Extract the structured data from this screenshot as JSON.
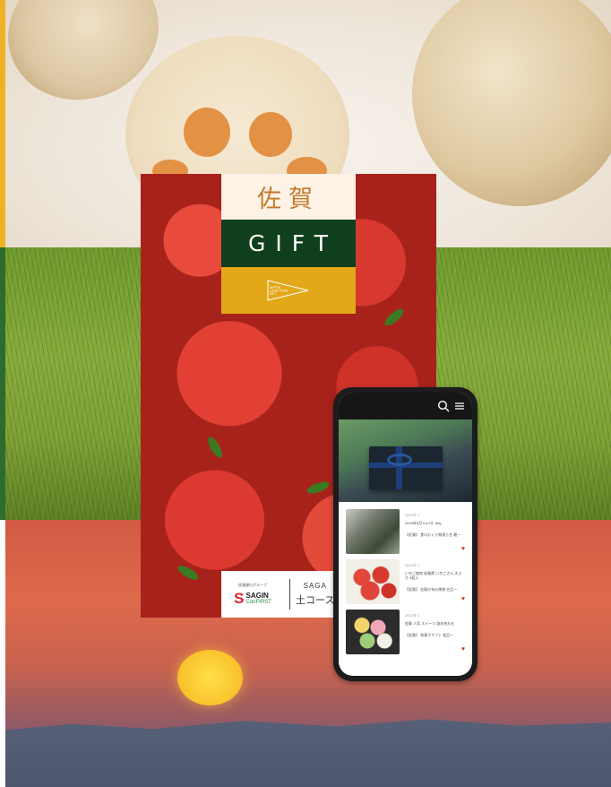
{
  "catalog": {
    "title_kanji": "佐賀",
    "title_gift": "GIFT",
    "badge_text": "NIPPON LOCAL FOOD GIFT",
    "footer": {
      "group_label": "佐賀銀行グループ",
      "sagin_mark": "S",
      "sagin_name": "SAGIN",
      "sagin_sub": "ConFIRST",
      "saga_label": "SAGA",
      "saga_kanji": "土コース"
    }
  },
  "phone": {
    "icons": [
      "search-icon",
      "menu-icon"
    ],
    "items": [
      {
        "date": "2021年 1",
        "title": "2019年5月 Inc.tス .6kg",
        "category": "【佐賀】 食のおくり物通り名 最一",
        "thumb_color": "#3e4a3a"
      },
      {
        "date": "2021年 1",
        "title": "いちご産地 佐賀県 いちごさん 大ぶり 4粒入",
        "category": "【佐賀】 佐賀の旬の果物 名品一",
        "thumb_color": "#c8322a"
      },
      {
        "date": "2021年 1",
        "title": "佐賀 人気 スイーツ 詰め合わせ",
        "category": "【佐賀】 和菓子ギフト 銘品一",
        "thumb_color": "#2c2c2c"
      }
    ]
  },
  "colors": {
    "gift_green": "#0f3f1c",
    "gift_gold": "#e2a81a",
    "kanji_orange": "#c27a2a",
    "accent_yellow": "#f0b225",
    "accent_green": "#2e6b2e"
  }
}
